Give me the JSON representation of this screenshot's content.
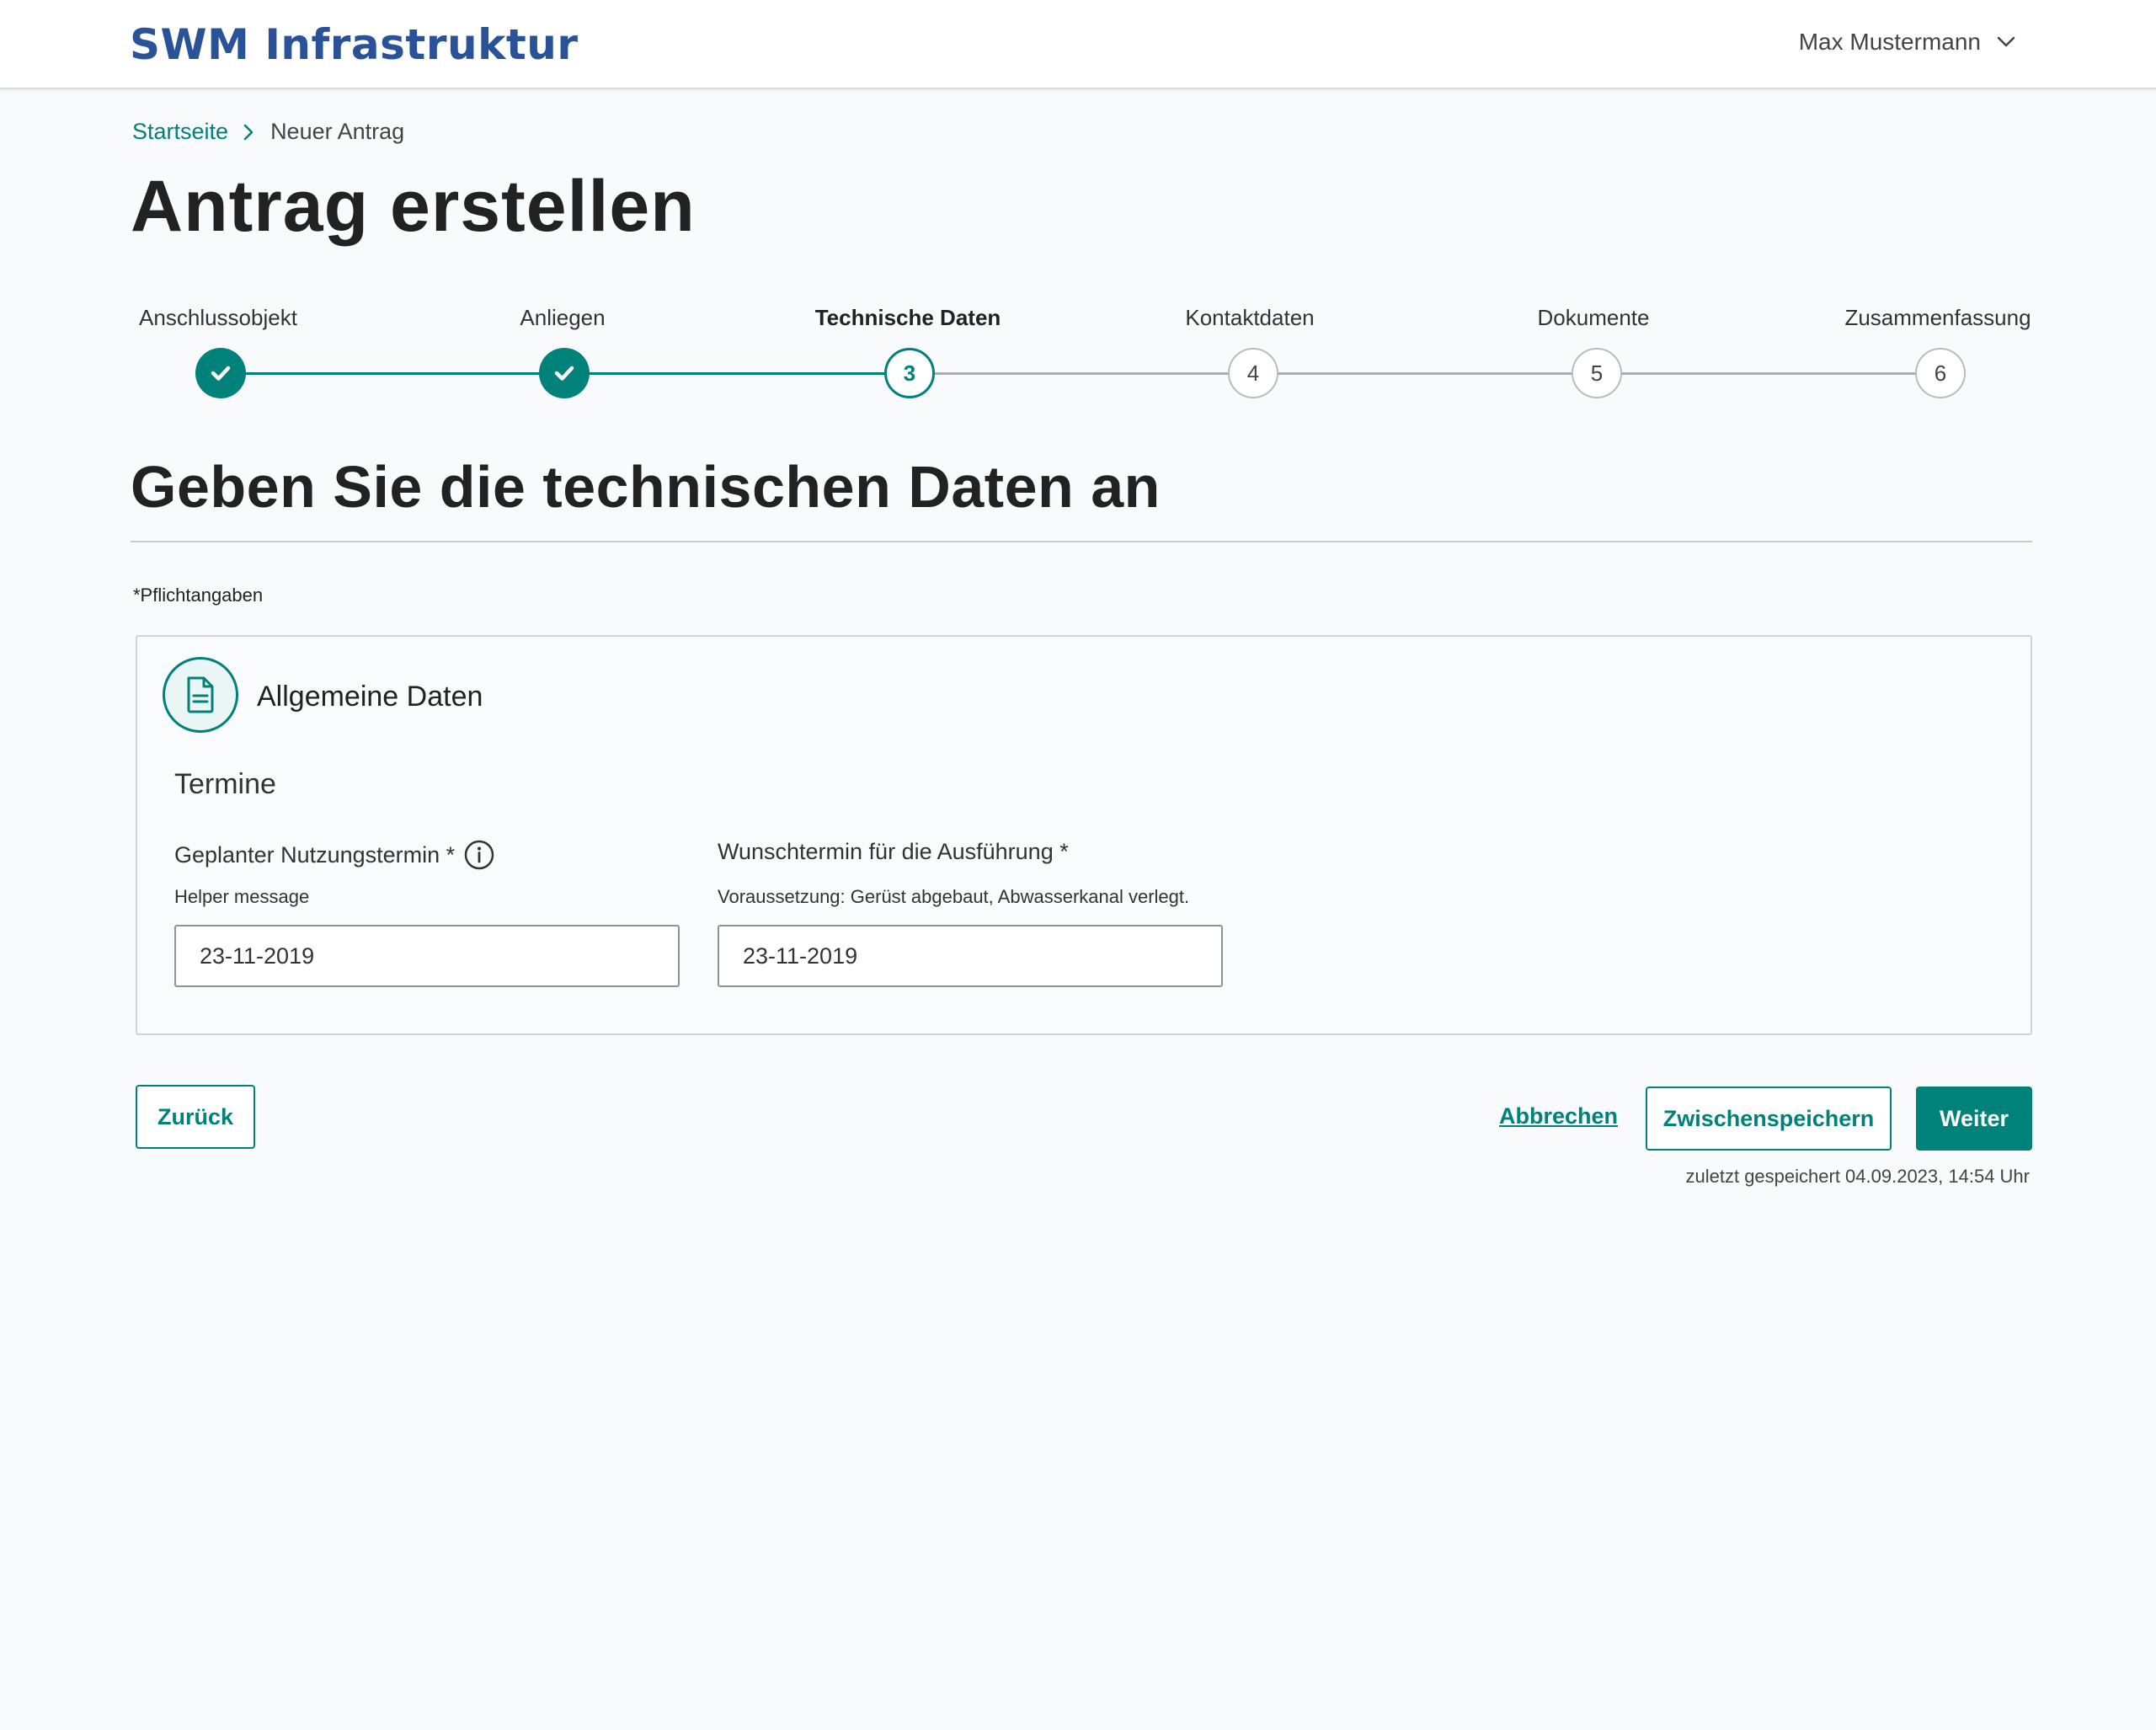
{
  "header": {
    "logo": "SWM Infrastruktur",
    "user_name": "Max Mustermann"
  },
  "breadcrumb": {
    "home": "Startseite",
    "current": "Neuer Antrag"
  },
  "page_title": "Antrag erstellen",
  "stepper": {
    "steps": [
      {
        "label": "Anschlussobjekt",
        "number": "1",
        "state": "done"
      },
      {
        "label": "Anliegen",
        "number": "2",
        "state": "done"
      },
      {
        "label": "Technische Daten",
        "number": "3",
        "state": "active"
      },
      {
        "label": "Kontaktdaten",
        "number": "4",
        "state": "todo"
      },
      {
        "label": "Dokumente",
        "number": "5",
        "state": "todo"
      },
      {
        "label": "Zusammenfassung",
        "number": "6",
        "state": "todo"
      }
    ]
  },
  "section_title": "Geben Sie die technischen Daten an",
  "required_note": "*Pflichtangaben",
  "card": {
    "title": "Allgemeine Daten",
    "group_title": "Termine",
    "fields": [
      {
        "label": "Geplanter Nutzungstermin *",
        "helper": "Helper message",
        "value": "23-11-2019"
      },
      {
        "label": "Wunschtermin für die Ausführung *",
        "helper": "Voraussetzung: Gerüst abgebaut, Abwasserkanal verlegt.",
        "value": "23-11-2019"
      }
    ]
  },
  "actions": {
    "back": "Zurück",
    "cancel": "Abbrechen",
    "save": "Zwischenspeichern",
    "next": "Weiter",
    "saved_note": "zuletzt gespeichert 04.09.2023, 14:54 Uhr"
  },
  "colors": {
    "accent": "#00817a",
    "brand": "#2a5298",
    "line_inactive": "#a9acb1"
  }
}
